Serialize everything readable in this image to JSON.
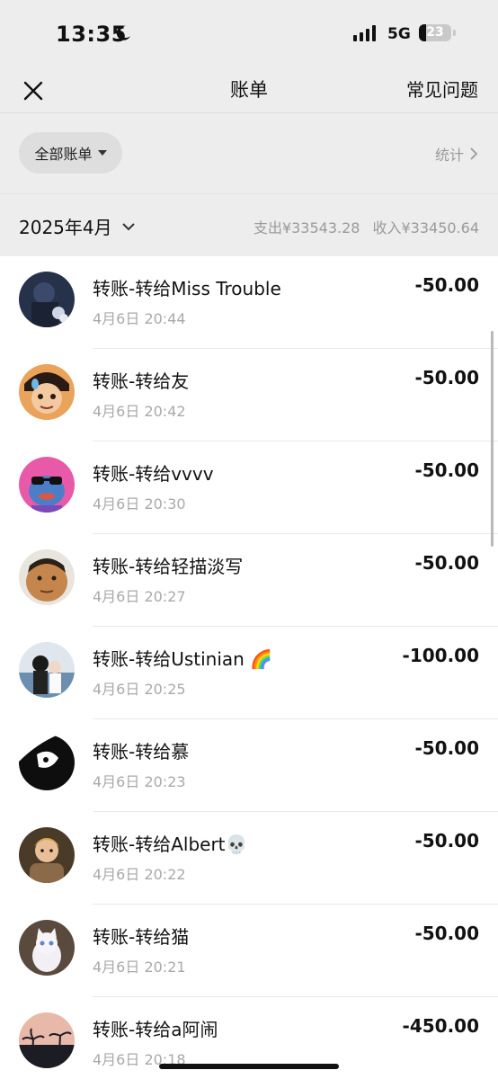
{
  "status_bar": {
    "time": "13:35",
    "network": "5G",
    "battery": "23",
    "battery_level": 0.23
  },
  "nav": {
    "title": "账单",
    "faq": "常见问题",
    "close_icon": "close-icon"
  },
  "filter": {
    "label": "全部账单",
    "stats_label": "统计"
  },
  "month_header": {
    "month": "2025年4月",
    "expense": "支出¥33543.28",
    "income": "收入¥33450.64"
  },
  "transactions": [
    {
      "title": "转账-转给Miss Trouble",
      "time": "4月6日 20:44",
      "amount": "-50.00"
    },
    {
      "title": "转账-转给友",
      "time": "4月6日 20:42",
      "amount": "-50.00"
    },
    {
      "title": "转账-转给vvvv",
      "time": "4月6日 20:30",
      "amount": "-50.00"
    },
    {
      "title": "转账-转给轻描淡写",
      "time": "4月6日 20:27",
      "amount": "-50.00"
    },
    {
      "title": "转账-转给Ustinian 🌈",
      "time": "4月6日 20:25",
      "amount": "-100.00"
    },
    {
      "title": "转账-转给慕",
      "time": "4月6日 20:23",
      "amount": "-50.00"
    },
    {
      "title": "转账-转给Albert💀",
      "time": "4月6日 20:22",
      "amount": "-50.00"
    },
    {
      "title": "转账-转给猫",
      "time": "4月6日 20:21",
      "amount": "-50.00"
    },
    {
      "title": "转账-转给a阿闹",
      "time": "4月6日 20:18",
      "amount": "-450.00"
    }
  ]
}
